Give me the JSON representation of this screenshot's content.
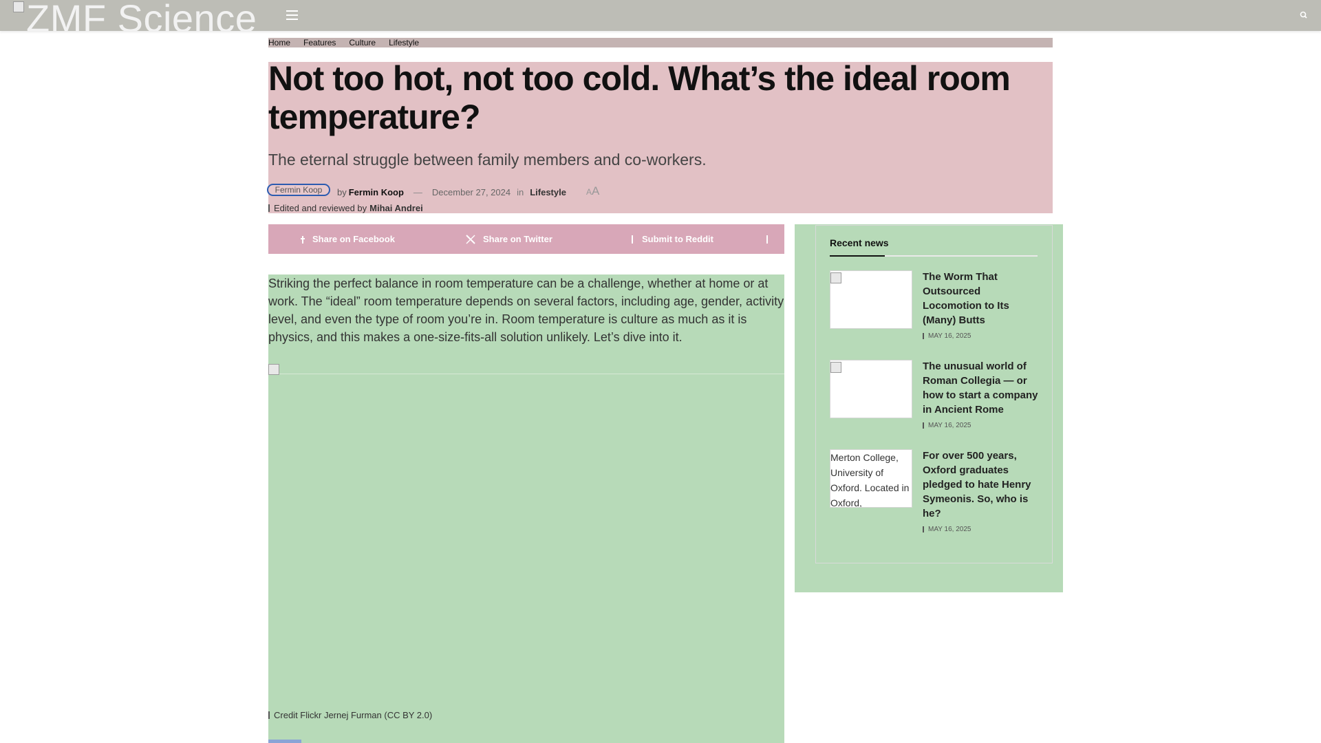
{
  "header": {
    "logo_alt": "ZMF Science",
    "menu_icon": "hamburger-menu-icon",
    "search_icon": "search-icon"
  },
  "breadcrumb": [
    "Home",
    "Features",
    "Culture",
    "Lifestyle"
  ],
  "article": {
    "title": "Not too hot, not too cold. What’s the ideal room temperature?",
    "subtitle": "The eternal struggle between family members and co-workers.",
    "avatar_alt": "Fermin Koop",
    "by": "by",
    "author": "Fermin Koop",
    "dash": "—",
    "date": "December 27, 2024",
    "in": "in",
    "category": "Lifestyle",
    "font_small": "A",
    "font_large": "A",
    "edited_label": "Edited and reviewed by",
    "editor": "Mihai Andrei",
    "paragraph": "Striking the perfect balance in room temperature can be a challenge, whether at home or at work. The “ideal” room temperature depends on several factors, including age, gender, activity level, and even the type of room you’re in. Room temperature is culture as much as it is physics, and this makes a one-size-fits-all solution unlikely. Let’s dive into it.",
    "image_caption": "Credit Flickr Jernej Furman (CC BY 2.0)"
  },
  "share": {
    "facebook": "Share on Facebook",
    "twitter": "Share on Twitter",
    "reddit": "Submit to Reddit"
  },
  "sidebar": {
    "title": "Recent news",
    "items": [
      {
        "title": "The Worm That Outsourced Locomotion to Its (Many) Butts",
        "date": "MAY 16, 2025",
        "thumb_alt": ""
      },
      {
        "title": "The unusual world of Roman Collegia — or how to start a company in Ancient Rome",
        "date": "MAY 16, 2025",
        "thumb_alt": ""
      },
      {
        "title": "For over 500 years, Oxford graduates pledged to hate Henry Symeonis. So, who is he?",
        "date": "MAY 16, 2025",
        "thumb_alt": "Merton College, University of Oxford. Located in Oxford,"
      }
    ]
  },
  "colors": {
    "topbar": "#bdbdb6",
    "header_box": "#e2c1c5",
    "share_bar": "#d8a7b8",
    "content_bg": "#b7dab8",
    "avatar_ring": "#2b5bb0"
  }
}
